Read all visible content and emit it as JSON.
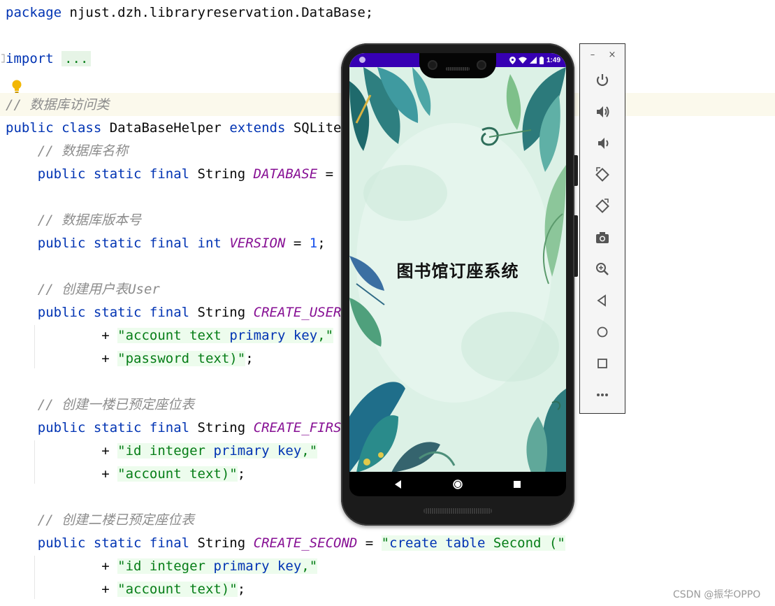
{
  "editor": {
    "lines": [
      [
        {
          "c": "kw",
          "t": "package"
        },
        {
          "c": "",
          "t": " njust.dzh.libraryreservation.DataBase;"
        }
      ],
      [
        {
          "c": "kw",
          "t": "import"
        },
        {
          "c": "",
          "t": " "
        },
        {
          "c": "fold",
          "t": "..."
        }
      ],
      [
        {
          "c": "cmt",
          "t": "// 数据库访问类"
        }
      ],
      [
        {
          "c": "kw",
          "t": "public class"
        },
        {
          "c": "",
          "t": " DataBaseHelper "
        },
        {
          "c": "kw",
          "t": "extends"
        },
        {
          "c": "",
          "t": " SQLiteO"
        }
      ],
      [
        {
          "c": "cmt",
          "t": "    // 数据库名称"
        }
      ],
      [
        {
          "c": "",
          "t": "    "
        },
        {
          "c": "kw",
          "t": "public static final"
        },
        {
          "c": "",
          "t": " String "
        },
        {
          "c": "fld",
          "t": "DATABASE"
        },
        {
          "c": "",
          "t": " = \""
        }
      ],
      [
        {
          "c": "cmt",
          "t": "    // 数据库版本号"
        }
      ],
      [
        {
          "c": "",
          "t": "    "
        },
        {
          "c": "kw",
          "t": "public static final int"
        },
        {
          "c": "",
          "t": " "
        },
        {
          "c": "fld",
          "t": "VERSION"
        },
        {
          "c": "",
          "t": " = "
        },
        {
          "c": "num",
          "t": "1"
        },
        {
          "c": "",
          "t": ";"
        }
      ],
      [
        {
          "c": "cmt",
          "t": "    // 创建用户表User"
        }
      ],
      [
        {
          "c": "",
          "t": "    "
        },
        {
          "c": "kw",
          "t": "public static final"
        },
        {
          "c": "",
          "t": " String "
        },
        {
          "c": "fld",
          "t": "CREATE_USER"
        }
      ],
      [
        {
          "c": "",
          "t": "            + "
        },
        {
          "c": "str",
          "t": "\"account text "
        },
        {
          "c": "kwstr",
          "t": "primary key"
        },
        {
          "c": "str",
          "t": ",\""
        }
      ],
      [
        {
          "c": "",
          "t": "            + "
        },
        {
          "c": "str",
          "t": "\"password text)\""
        },
        {
          "c": "",
          "t": ";"
        }
      ],
      [
        {
          "c": "cmt",
          "t": "    // 创建一楼已预定座位表"
        }
      ],
      [
        {
          "c": "",
          "t": "    "
        },
        {
          "c": "kw",
          "t": "public static final"
        },
        {
          "c": "",
          "t": " String "
        },
        {
          "c": "fld",
          "t": "CREATE_FIRST"
        }
      ],
      [
        {
          "c": "",
          "t": "            + "
        },
        {
          "c": "str",
          "t": "\"id integer "
        },
        {
          "c": "kwstr",
          "t": "primary key"
        },
        {
          "c": "str",
          "t": ",\""
        }
      ],
      [
        {
          "c": "",
          "t": "            + "
        },
        {
          "c": "str",
          "t": "\"account text)\""
        },
        {
          "c": "",
          "t": ";"
        }
      ],
      [
        {
          "c": "cmt",
          "t": "    // 创建二楼已预定座位表"
        }
      ],
      [
        {
          "c": "",
          "t": "    "
        },
        {
          "c": "kw",
          "t": "public static final"
        },
        {
          "c": "",
          "t": " String "
        },
        {
          "c": "fld",
          "t": "CREATE_SECOND"
        },
        {
          "c": "",
          "t": " = "
        },
        {
          "c": "str",
          "t": "\""
        },
        {
          "c": "kwstr",
          "t": "create table"
        },
        {
          "c": "str",
          "t": " Second (\""
        }
      ],
      [
        {
          "c": "",
          "t": "            + "
        },
        {
          "c": "str",
          "t": "\"id integer "
        },
        {
          "c": "kwstr",
          "t": "primary key"
        },
        {
          "c": "str",
          "t": ",\""
        }
      ],
      [
        {
          "c": "",
          "t": "            + "
        },
        {
          "c": "str",
          "t": "\"account text)\""
        },
        {
          "c": "",
          "t": ";"
        }
      ]
    ]
  },
  "phone": {
    "status_time": "1:49",
    "app_title": "图书馆订座系统",
    "nav": {
      "back_icon": "triangle-back-icon",
      "home_icon": "circle-home-icon",
      "recents_icon": "square-recents-icon"
    }
  },
  "emulator_toolbar": {
    "minimize": "–",
    "close": "×",
    "buttons": [
      "power-icon",
      "volume-up-icon",
      "volume-down-icon",
      "rotate-left-icon",
      "rotate-right-icon",
      "camera-icon",
      "zoom-icon",
      "back-icon",
      "home-icon",
      "overview-icon",
      "more-icon"
    ]
  },
  "watermark": "CSDN @振华OPPO",
  "colors": {
    "keyword": "#0033b3",
    "string": "#067d17",
    "comment": "#8c8c8c",
    "field": "#871094",
    "number": "#1750eb",
    "status_bar": "#3700b3"
  }
}
